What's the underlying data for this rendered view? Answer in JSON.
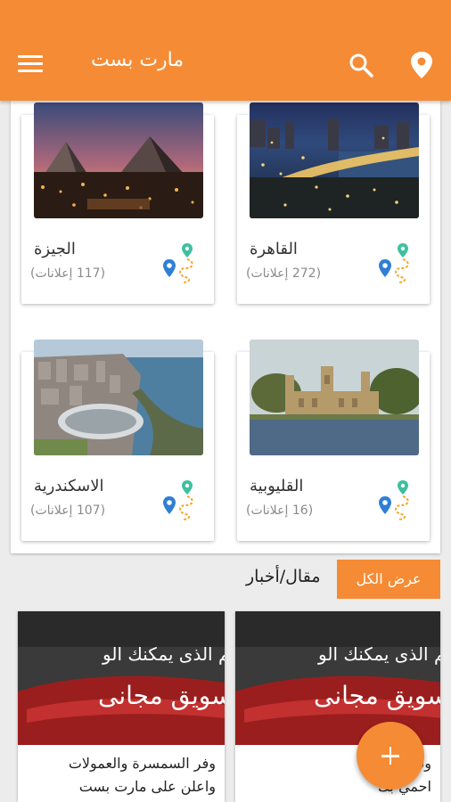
{
  "app_bar": {
    "title": "مارت بست",
    "menu_icon": "menu-icon",
    "search_icon": "search-icon",
    "location_icon": "location-pin-icon",
    "color": "#f58b34"
  },
  "cities": [
    {
      "name": "الجيزة",
      "count": "(117 إعلانات)",
      "photo": "giza-pyramids"
    },
    {
      "name": "القاهرة",
      "count": "(272 إعلانات)",
      "photo": "cairo-night"
    },
    {
      "name": "الاسكندرية",
      "count": "(107 إعلانات)",
      "photo": "alexandria-library"
    },
    {
      "name": "القليوبية",
      "count": "(16 إعلانات)",
      "photo": "qalyubia-palace"
    }
  ],
  "articles_section": {
    "title": "مقال/أخبار",
    "view_all": "عرض الكل"
  },
  "articles": [
    {
      "headline": "الاسم الذى يمكنك الو",
      "slogan": "تسويق مجانى",
      "text_line1": "وفر السمسرة والعمولات",
      "text_line2": "واعلن على مارت بست"
    },
    {
      "headline": "الاسم الذى يمكنك الو",
      "slogan": "تسويق مجانى",
      "text_line1": "وفرت",
      "text_line2": "احمي بك"
    }
  ],
  "fab": {
    "icon": "add-icon"
  }
}
